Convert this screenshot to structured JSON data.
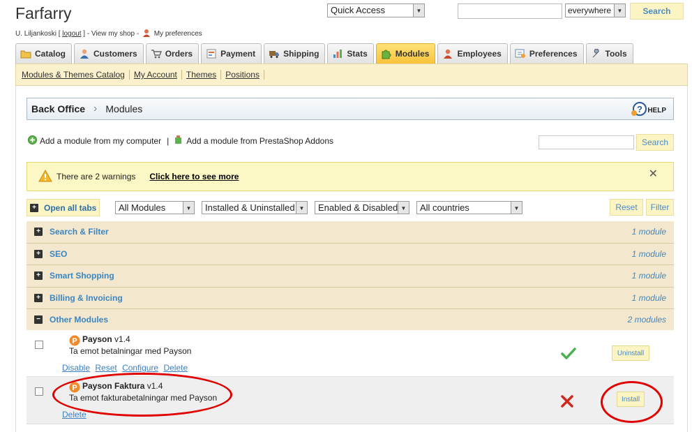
{
  "header": {
    "shop_title": "Farfarry",
    "user_name": "U. Liljankoski",
    "logout_label": "logout",
    "view_shop_label": "View my shop",
    "preferences_label": "My preferences"
  },
  "top_bar": {
    "quick_access_label": "Quick Access",
    "search_value": "",
    "scope_label": "everywhere",
    "search_button": "Search"
  },
  "tabs": [
    {
      "label": "Catalog",
      "icon": "folder-icon"
    },
    {
      "label": "Customers",
      "icon": "user-icon"
    },
    {
      "label": "Orders",
      "icon": "cart-icon"
    },
    {
      "label": "Payment",
      "icon": "payment-icon"
    },
    {
      "label": "Shipping",
      "icon": "truck-icon"
    },
    {
      "label": "Stats",
      "icon": "chart-icon"
    },
    {
      "label": "Modules",
      "icon": "puzzle-icon"
    },
    {
      "label": "Employees",
      "icon": "employee-icon"
    },
    {
      "label": "Preferences",
      "icon": "preferences-icon"
    },
    {
      "label": "Tools",
      "icon": "wrench-icon"
    }
  ],
  "active_tab": "Modules",
  "subnav": [
    "Modules & Themes Catalog",
    "My Account",
    "Themes",
    "Positions"
  ],
  "breadcrumb": {
    "root": "Back Office",
    "current": "Modules",
    "help_label": "HELP"
  },
  "add_module": {
    "from_computer": "Add a module from my computer",
    "separator": "|",
    "from_addons": "Add a module from PrestaShop Addons"
  },
  "module_search": {
    "value": "",
    "button": "Search"
  },
  "warning": {
    "text": "There are 2 warnings",
    "link": "Click here to see more"
  },
  "filters": {
    "open_all_tabs": "Open all tabs",
    "modules": "All Modules",
    "install_state": "Installed & Uninstalled",
    "enabled_state": "Enabled & Disabled",
    "countries": "All countries",
    "reset_button": "Reset",
    "filter_button": "Filter"
  },
  "categories": [
    {
      "name": "Search & Filter",
      "count": "1 module",
      "expanded": false
    },
    {
      "name": "SEO",
      "count": "1 module",
      "expanded": false
    },
    {
      "name": "Smart Shopping",
      "count": "1 module",
      "expanded": false
    },
    {
      "name": "Billing & Invoicing",
      "count": "1 module",
      "expanded": false
    },
    {
      "name": "Other Modules",
      "count": "2 modules",
      "expanded": true
    }
  ],
  "modules": [
    {
      "name": "Payson",
      "version": "v1.4",
      "description": "Ta emot betalningar med Payson",
      "actions": [
        "Disable",
        "Reset",
        "Configure",
        "Delete"
      ],
      "installed": true,
      "button": "Uninstall"
    },
    {
      "name": "Payson Faktura",
      "version": "v1.4",
      "description": "Ta emot fakturabetalningar med Payson",
      "actions": [
        "Delete"
      ],
      "installed": false,
      "button": "Install"
    }
  ],
  "colors": {
    "active_tab": "#f7c33a",
    "link_blue": "#3d85c0",
    "category_bg": "#f3e7cd",
    "warning_bg": "#fcf8c6",
    "annotation_red": "#e00000",
    "check_green": "#4caf50",
    "cross_red": "#d0281c"
  }
}
